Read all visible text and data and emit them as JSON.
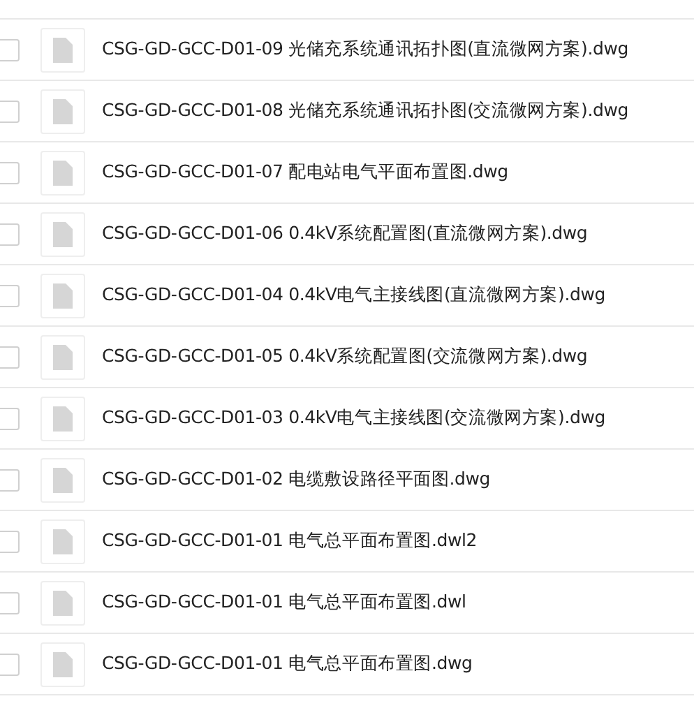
{
  "files": [
    {
      "name": "CSG-GD-GCC-D01-09 光储充系统通讯拓扑图(直流微网方案).dwg",
      "checked": false
    },
    {
      "name": "CSG-GD-GCC-D01-08 光储充系统通讯拓扑图(交流微网方案).dwg",
      "checked": false
    },
    {
      "name": "CSG-GD-GCC-D01-07 配电站电气平面布置图.dwg",
      "checked": false
    },
    {
      "name": "CSG-GD-GCC-D01-06 0.4kV系统配置图(直流微网方案).dwg",
      "checked": false
    },
    {
      "name": "CSG-GD-GCC-D01-04 0.4kV电气主接线图(直流微网方案).dwg",
      "checked": false
    },
    {
      "name": "CSG-GD-GCC-D01-05 0.4kV系统配置图(交流微网方案).dwg",
      "checked": false
    },
    {
      "name": "CSG-GD-GCC-D01-03 0.4kV电气主接线图(交流微网方案).dwg",
      "checked": false
    },
    {
      "name": "CSG-GD-GCC-D01-02 电缆敷设路径平面图.dwg",
      "checked": false
    },
    {
      "name": "CSG-GD-GCC-D01-01 电气总平面布置图.dwl2",
      "checked": false
    },
    {
      "name": "CSG-GD-GCC-D01-01 电气总平面布置图.dwl",
      "checked": false
    },
    {
      "name": "CSG-GD-GCC-D01-01 电气总平面布置图.dwg",
      "checked": false
    }
  ]
}
